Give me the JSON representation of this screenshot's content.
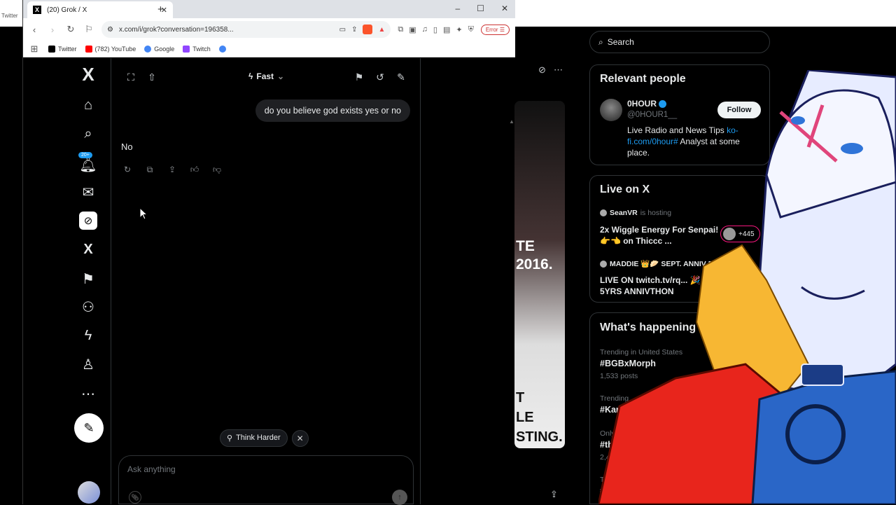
{
  "background": {
    "top_label": "Twitter"
  },
  "browser": {
    "tab": {
      "title": "(20) Grok / X",
      "close": "✕"
    },
    "new_tab": "+",
    "window_controls": [
      "–",
      "☐",
      "✕"
    ],
    "url": "x.com/i/grok?conversation=196358...",
    "error_label": "Error",
    "bookmarks": [
      {
        "label": "Twitter",
        "color": "#000000"
      },
      {
        "label": "(782) YouTube",
        "color": "#ff0000"
      },
      {
        "label": "Google",
        "color": "#4285f4"
      },
      {
        "label": "Twitch",
        "color": "#9146ff"
      },
      {
        "label": "",
        "color": "#4285f4"
      }
    ]
  },
  "nav": {
    "logo": "X",
    "notification_badge": "20+",
    "icons": [
      "home-icon",
      "explore-icon",
      "notifications-icon",
      "messages-icon",
      "grok-icon",
      "premium-icon",
      "bookmarks-icon",
      "communities-icon",
      "verified-orgs-icon",
      "profile-icon",
      "more-icon"
    ]
  },
  "chat": {
    "mode_label": "Fast",
    "user_message": "do you believe god exists yes or no",
    "answer": "No",
    "think_harder_label": "Think Harder",
    "input_placeholder": "Ask anything"
  },
  "sidebar": {
    "search_placeholder": "Search",
    "relevant_people": {
      "title": "Relevant people",
      "name": "0HOUR",
      "handle": "@0HOUR1__",
      "follow_label": "Follow",
      "bio_text": "Live Radio and News Tips ",
      "bio_link": "ko-fi.com/0hour#",
      "bio_rest": " Analyst at some place."
    },
    "live": {
      "title": "Live on X",
      "items": [
        {
          "host": "SeanVR",
          "sub": "is hosting",
          "title": "2x Wiggle Energy For Senpai! 👉👈 on Thiccc ...",
          "badge": "+445"
        },
        {
          "host": "MADDIE 👑🥟 SEPT. ANNIV D",
          "sub": "",
          "title": "LIVE ON twitch.tv/rq... 🎉 5YRS ANNIVTHON",
          "badge": ""
        }
      ]
    },
    "trends": {
      "title": "What's happening",
      "items": [
        {
          "context": "Trending in United States",
          "tag": "#BGBxMorph",
          "count": "1,533 posts"
        },
        {
          "context": "Trending",
          "tag": "#KarenRea",
          "count": ""
        },
        {
          "context": "Only on X",
          "tag": "#thu",
          "count": "2,452"
        },
        {
          "context": "Tre",
          "tag": "#",
          "count": ""
        }
      ]
    }
  },
  "media": {
    "text_top": "TE\n2016.",
    "text_bottom": "T\nLE\nSTING."
  }
}
